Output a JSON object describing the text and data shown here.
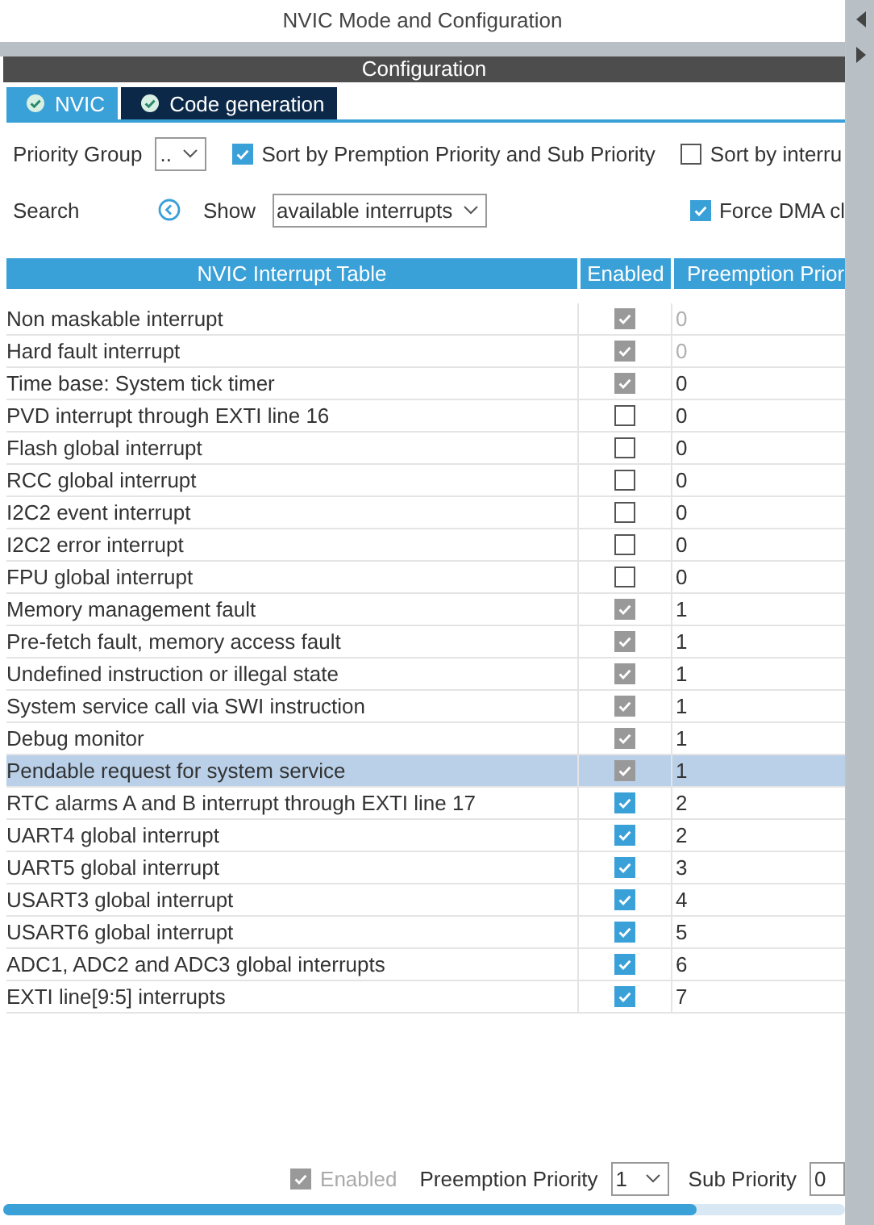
{
  "window": {
    "title": "NVIC Mode and Configuration"
  },
  "section": {
    "title": "Configuration"
  },
  "tabs": [
    {
      "label": "NVIC",
      "selected": true
    },
    {
      "label": "Code generation",
      "selected": false
    }
  ],
  "controls": {
    "priority_group": {
      "label": "Priority Group",
      "value": ".."
    },
    "sort_premption": {
      "label": "Sort by Premption Priority and Sub Priority",
      "checked": true
    },
    "sort_interrupt": {
      "label": "Sort by interru",
      "checked": false
    },
    "search": {
      "label": "Search"
    },
    "show": {
      "label": "Show",
      "value": "available interrupts"
    },
    "force_dma": {
      "label": "Force DMA cl",
      "checked": true
    }
  },
  "table": {
    "columns": [
      "NVIC Interrupt Table",
      "Enabled",
      "Preemption Prior"
    ],
    "rows": [
      {
        "name": "Non maskable interrupt",
        "enabled": true,
        "disabled": true,
        "preemption": "0",
        "preemption_disabled": true,
        "selected": false
      },
      {
        "name": "Hard fault interrupt",
        "enabled": true,
        "disabled": true,
        "preemption": "0",
        "preemption_disabled": true,
        "selected": false
      },
      {
        "name": "Time base: System tick timer",
        "enabled": true,
        "disabled": true,
        "preemption": "0",
        "preemption_disabled": false,
        "selected": false
      },
      {
        "name": "PVD interrupt through EXTI line 16",
        "enabled": false,
        "disabled": false,
        "preemption": "0",
        "preemption_disabled": false,
        "selected": false
      },
      {
        "name": "Flash global interrupt",
        "enabled": false,
        "disabled": false,
        "preemption": "0",
        "preemption_disabled": false,
        "selected": false
      },
      {
        "name": "RCC global interrupt",
        "enabled": false,
        "disabled": false,
        "preemption": "0",
        "preemption_disabled": false,
        "selected": false
      },
      {
        "name": "I2C2 event interrupt",
        "enabled": false,
        "disabled": false,
        "preemption": "0",
        "preemption_disabled": false,
        "selected": false
      },
      {
        "name": "I2C2 error interrupt",
        "enabled": false,
        "disabled": false,
        "preemption": "0",
        "preemption_disabled": false,
        "selected": false
      },
      {
        "name": "FPU global interrupt",
        "enabled": false,
        "disabled": false,
        "preemption": "0",
        "preemption_disabled": false,
        "selected": false
      },
      {
        "name": "Memory management fault",
        "enabled": true,
        "disabled": true,
        "preemption": "1",
        "preemption_disabled": false,
        "selected": false
      },
      {
        "name": "Pre-fetch fault, memory access fault",
        "enabled": true,
        "disabled": true,
        "preemption": "1",
        "preemption_disabled": false,
        "selected": false
      },
      {
        "name": "Undefined instruction or illegal state",
        "enabled": true,
        "disabled": true,
        "preemption": "1",
        "preemption_disabled": false,
        "selected": false
      },
      {
        "name": "System service call via SWI instruction",
        "enabled": true,
        "disabled": true,
        "preemption": "1",
        "preemption_disabled": false,
        "selected": false
      },
      {
        "name": "Debug monitor",
        "enabled": true,
        "disabled": true,
        "preemption": "1",
        "preemption_disabled": false,
        "selected": false
      },
      {
        "name": "Pendable request for system service",
        "enabled": true,
        "disabled": true,
        "preemption": "1",
        "preemption_disabled": false,
        "selected": true
      },
      {
        "name": "RTC alarms A and B interrupt through EXTI line 17",
        "enabled": true,
        "disabled": false,
        "preemption": "2",
        "preemption_disabled": false,
        "selected": false
      },
      {
        "name": "UART4 global interrupt",
        "enabled": true,
        "disabled": false,
        "preemption": "2",
        "preemption_disabled": false,
        "selected": false
      },
      {
        "name": "UART5 global interrupt",
        "enabled": true,
        "disabled": false,
        "preemption": "3",
        "preemption_disabled": false,
        "selected": false
      },
      {
        "name": "USART3 global interrupt",
        "enabled": true,
        "disabled": false,
        "preemption": "4",
        "preemption_disabled": false,
        "selected": false
      },
      {
        "name": "USART6 global interrupt",
        "enabled": true,
        "disabled": false,
        "preemption": "5",
        "preemption_disabled": false,
        "selected": false
      },
      {
        "name": "ADC1, ADC2 and ADC3 global interrupts",
        "enabled": true,
        "disabled": false,
        "preemption": "6",
        "preemption_disabled": false,
        "selected": false
      },
      {
        "name": "EXTI line[9:5] interrupts",
        "enabled": true,
        "disabled": false,
        "preemption": "7",
        "preemption_disabled": false,
        "selected": false
      }
    ]
  },
  "footer": {
    "enabled": {
      "label": "Enabled",
      "checked": true,
      "disabled": true
    },
    "preemption": {
      "label": "Preemption Priority",
      "value": "1"
    },
    "sub": {
      "label": "Sub Priority",
      "value": "0"
    }
  }
}
